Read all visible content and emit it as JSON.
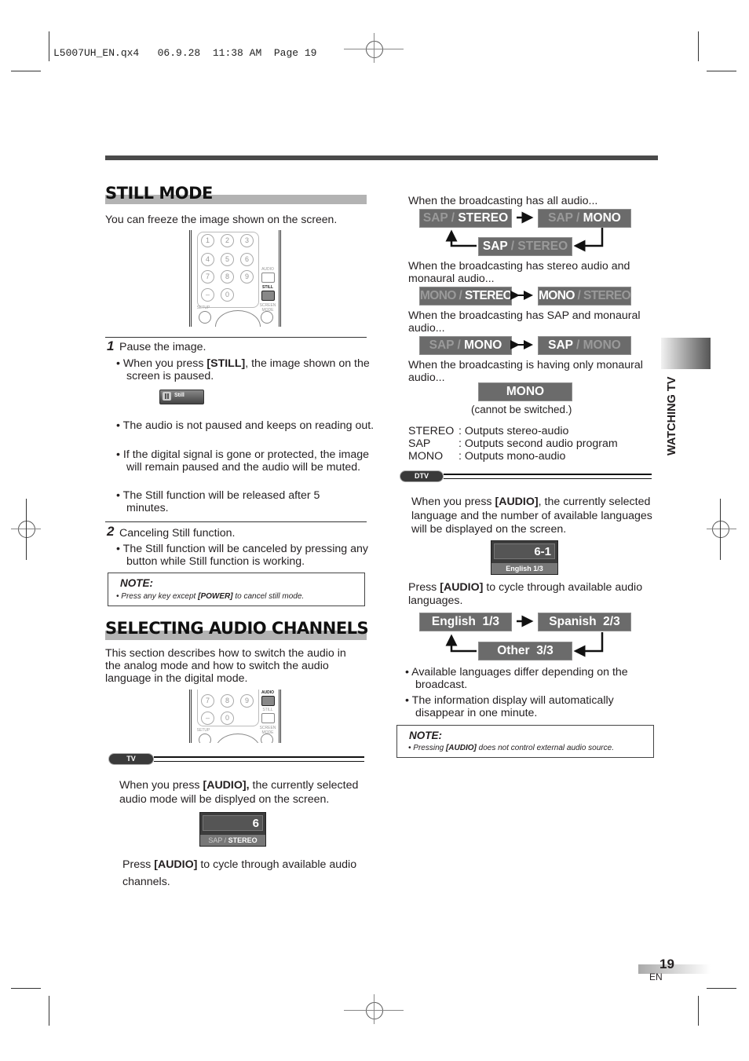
{
  "print_header": {
    "file": "L5007UH_EN.qx4",
    "date": "06.9.28",
    "time": "11:38 AM",
    "page_label": "Page 19"
  },
  "still_mode": {
    "title": "STILL MODE",
    "intro": "You can freeze the image shown on the screen.",
    "remote": {
      "keys": [
        "1",
        "2",
        "3",
        "4",
        "5",
        "6",
        "7",
        "8",
        "9",
        "–",
        "0"
      ],
      "audio_label": "AUDIO",
      "still_label": "STILL",
      "setup_label": "SETUP",
      "screen_mode_label": "SCREEN MODE",
      "highlighted": "STILL"
    },
    "step1": {
      "number": "1",
      "heading": "Pause the image.",
      "bullet1_pre": "• When you press ",
      "bullet1_key": "[STILL]",
      "bullet1_post": ", the image shown on the screen is paused.",
      "osd_label": "Still",
      "bullets": [
        "• The audio is not paused and keeps on reading out.",
        "• If the digital signal is gone or protected, the image will remain paused and the audio will be muted.",
        "• The Still function will be released after 5 minutes."
      ]
    },
    "step2": {
      "number": "2",
      "heading": "Canceling Still function.",
      "bullet": "• The Still function will be canceled by pressing any button while Still function is working."
    },
    "note": {
      "heading": "NOTE:",
      "pre": "• Press any key except ",
      "key": "[POWER]",
      "post": " to cancel still mode."
    }
  },
  "audio_channels": {
    "title": "SELECTING AUDIO CHANNELS",
    "intro": "This section describes how to switch the audio in the analog mode and how to switch the audio language in the digital mode.",
    "remote": {
      "keys": [
        "7",
        "8",
        "9",
        "–",
        "0"
      ],
      "audio_label": "AUDIO",
      "still_label": "STILL",
      "setup_label": "SETUP",
      "screen_mode_label": "SCREEN MODE",
      "highlighted": "AUDIO"
    },
    "tv": {
      "badge": "TV",
      "press_pre": "When you press ",
      "press_key": "[AUDIO],",
      "press_post": " the currently selected audio mode will be displyed on the screen.",
      "osd_channel": "6",
      "osd_mode_dim": "SAP / ",
      "osd_mode_lit": "STEREO",
      "cycle_pre": "Press ",
      "cycle_key": "[AUDIO]",
      "cycle_post": " to cycle through available audio channels."
    },
    "broadcast_cases": [
      {
        "caption": "When the broadcasting has all audio...",
        "modes": [
          {
            "dim": "SAP / ",
            "lit": "STEREO",
            "order": "dim-first"
          },
          {
            "dim": "SAP / ",
            "lit": "MONO",
            "order": "dim-first"
          },
          {
            "lit": "SAP",
            "dim": " / STEREO",
            "order": "lit-first"
          }
        ],
        "flow": "cycle"
      },
      {
        "caption": "When the broadcasting has stereo audio and monaural audio...",
        "modes": [
          {
            "dim": "MONO / ",
            "lit": "STEREO",
            "order": "dim-first"
          },
          {
            "lit": "MONO",
            "dim": " / STEREO",
            "order": "lit-first"
          }
        ],
        "flow": "toggle"
      },
      {
        "caption": "When the broadcasting has SAP and monaural audio...",
        "modes": [
          {
            "dim": "SAP / ",
            "lit": "MONO",
            "order": "dim-first"
          },
          {
            "lit": "SAP",
            "dim": " / MONO",
            "order": "lit-first"
          }
        ],
        "flow": "toggle"
      },
      {
        "caption": "When the broadcasting is having only monaural audio...",
        "modes": [
          {
            "lit": "MONO"
          }
        ],
        "flow": "none",
        "footnote": "(cannot be switched.)"
      }
    ],
    "legend": [
      {
        "term": "STEREO",
        "desc": ": Outputs stereo-audio"
      },
      {
        "term": "SAP",
        "desc": ": Outputs second audio program"
      },
      {
        "term": "MONO",
        "desc": ": Outputs mono-audio"
      }
    ],
    "dtv": {
      "badge": "DTV",
      "press_pre": "When you press ",
      "press_key": "[AUDIO]",
      "press_post": ", the currently selected language and the number of available languages will be displayed on the screen.",
      "osd_channel": "6-1",
      "osd_language": "English 1/3",
      "cycle_pre": "Press ",
      "cycle_key": "[AUDIO]",
      "cycle_post": " to cycle through available audio languages.",
      "languages": [
        "English  1/3",
        "Spanish  2/3",
        "Other  3/3"
      ],
      "bullets": [
        "• Available languages differ depending on the broadcast.",
        "• The information display will automatically disappear in one minute."
      ],
      "note": {
        "heading": "NOTE:",
        "pre": "• Pressing ",
        "key": "[AUDIO]",
        "post": " does not control external audio source."
      }
    }
  },
  "side_tab": "WATCHING TV",
  "footer": {
    "page_number": "19",
    "lang": "EN"
  }
}
